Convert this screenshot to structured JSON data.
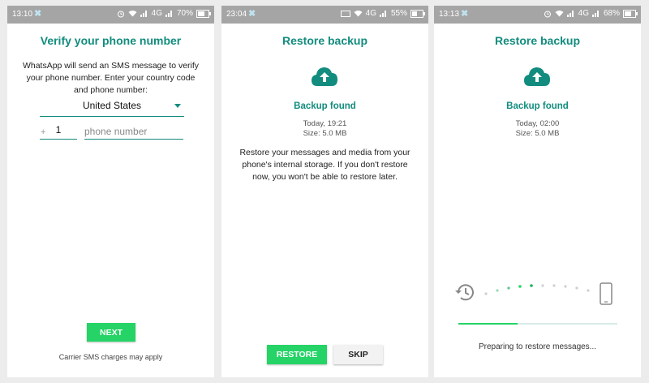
{
  "screens": [
    {
      "status": {
        "time": "13:10",
        "battery": "70%",
        "network": "4G"
      },
      "title": "Verify your phone number",
      "description": "WhatsApp will send an SMS message to verify your phone number. Enter your country code and phone number:",
      "country": "United States",
      "plus": "+",
      "country_code": "1",
      "phone_placeholder": "phone number",
      "next_label": "NEXT",
      "footnote": "Carrier SMS charges may apply"
    },
    {
      "status": {
        "time": "23:04",
        "battery": "55%",
        "network": "4G"
      },
      "title": "Restore backup",
      "found_label": "Backup found",
      "date": "Today, 19:21",
      "size": "Size: 5.0 MB",
      "description": "Restore your messages and media from your phone's internal storage. If you don't restore now, you won't be able to restore later.",
      "restore_label": "RESTORE",
      "skip_label": "SKIP"
    },
    {
      "status": {
        "time": "13:13",
        "battery": "68%",
        "network": "4G"
      },
      "title": "Restore backup",
      "found_label": "Backup found",
      "date": "Today, 02:00",
      "size": "Size: 5.0 MB",
      "progress_fraction": 0.37,
      "status_text": "Preparing to restore messages..."
    }
  ],
  "icons": [
    "cloud-upload-icon",
    "history-icon",
    "phone-device-icon",
    "wifi-icon",
    "signal-icon",
    "battery-icon",
    "alarm-icon"
  ],
  "colors": {
    "accent": "#128c7e",
    "button": "#25d366",
    "statusbar": "#a5a5a5",
    "background": "#ececec"
  }
}
